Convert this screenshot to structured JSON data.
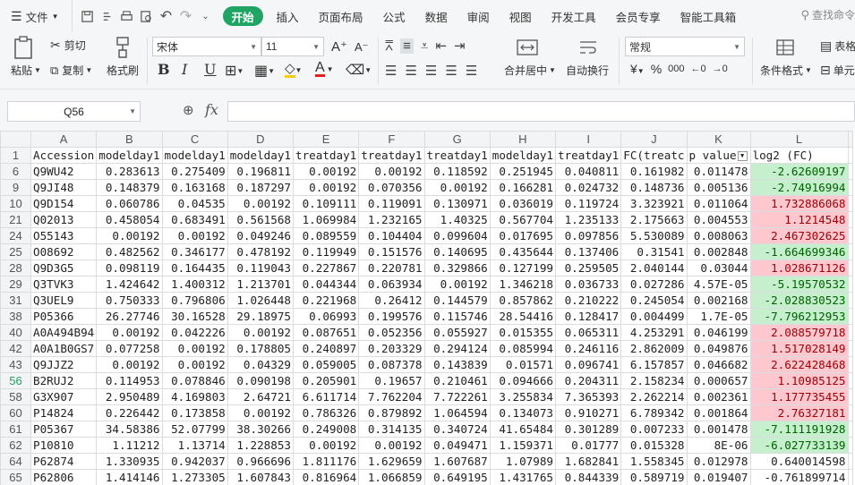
{
  "menubar": {
    "file_label": "文件",
    "tabs": [
      {
        "label": "开始",
        "active": true
      },
      {
        "label": "插入"
      },
      {
        "label": "页面布局"
      },
      {
        "label": "公式"
      },
      {
        "label": "数据"
      },
      {
        "label": "审阅"
      },
      {
        "label": "视图"
      },
      {
        "label": "开发工具"
      },
      {
        "label": "会员专享"
      },
      {
        "label": "智能工具箱"
      }
    ],
    "search_label": "查找命令"
  },
  "ribbon": {
    "paste": "粘贴",
    "cut": "剪切",
    "copy": "复制",
    "format_painter": "格式刷",
    "font_name": "宋体",
    "font_size": "11",
    "bold": "B",
    "italic": "I",
    "underline": "U",
    "font_color_letter": "A",
    "merge_center": "合并居中",
    "wrap_text": "自动换行",
    "number_format": "常规",
    "currency_symbol": "¥",
    "percent_symbol": "%",
    "thousands_symbol": "000",
    "conditional_format": "条件格式",
    "table_style": "表格",
    "cell_label": "单元",
    "font_grow": "A⁺",
    "font_shrink": "A⁻"
  },
  "formula_bar": {
    "name_box": "Q56",
    "fx": "fx",
    "formula": ""
  },
  "sheet": {
    "columns": [
      "A",
      "B",
      "C",
      "D",
      "E",
      "F",
      "G",
      "H",
      "I",
      "J",
      "K",
      "L"
    ],
    "header_row": {
      "row_num": "1",
      "cells": [
        "Accession",
        "modelday1",
        "modelday1",
        "modelday1",
        "treatday1",
        "treatday1",
        "treatday1",
        "modelday1",
        "treatday1",
        "FC(treatc",
        "p value",
        "log2 (FC)"
      ]
    },
    "rows": [
      {
        "n": "6",
        "cells": [
          "Q9WU42",
          "0.283613",
          "0.275409",
          "0.196811",
          "0.00192",
          "0.00192",
          "0.118592",
          "0.251945",
          "0.040811",
          "0.161982",
          "0.011478",
          "-2.62609197"
        ],
        "fill": "g"
      },
      {
        "n": "9",
        "cells": [
          "Q9JI48",
          "0.148379",
          "0.163168",
          "0.187297",
          "0.00192",
          "0.070356",
          "0.00192",
          "0.166281",
          "0.024732",
          "0.148736",
          "0.005136",
          "-2.74916994"
        ],
        "fill": "g"
      },
      {
        "n": "10",
        "cells": [
          "Q9D154",
          "0.060786",
          "0.04535",
          "0.00192",
          "0.109111",
          "0.119091",
          "0.130971",
          "0.036019",
          "0.119724",
          "3.323921",
          "0.011064",
          "1.732886068"
        ],
        "fill": "r"
      },
      {
        "n": "21",
        "cells": [
          "Q02013",
          "0.458054",
          "0.683491",
          "0.561568",
          "1.069984",
          "1.232165",
          "1.40325",
          "0.567704",
          "1.235133",
          "2.175663",
          "0.004553",
          "1.1214548"
        ],
        "fill": "r"
      },
      {
        "n": "24",
        "cells": [
          "O55143",
          "0.00192",
          "0.00192",
          "0.049246",
          "0.089559",
          "0.104404",
          "0.099604",
          "0.017695",
          "0.097856",
          "5.530089",
          "0.008063",
          "2.467302625"
        ],
        "fill": "r"
      },
      {
        "n": "25",
        "cells": [
          "O08692",
          "0.482562",
          "0.346177",
          "0.478192",
          "0.119949",
          "0.151576",
          "0.140695",
          "0.435644",
          "0.137406",
          "0.31541",
          "0.002848",
          "-1.664699346"
        ],
        "fill": "g"
      },
      {
        "n": "28",
        "cells": [
          "Q9D3G5",
          "0.098119",
          "0.164435",
          "0.119043",
          "0.227867",
          "0.220781",
          "0.329866",
          "0.127199",
          "0.259505",
          "2.040144",
          "0.03044",
          "1.028671126"
        ],
        "fill": "r"
      },
      {
        "n": "29",
        "cells": [
          "Q3TVK3",
          "1.424642",
          "1.400312",
          "1.213701",
          "0.044344",
          "0.063934",
          "0.00192",
          "1.346218",
          "0.036733",
          "0.027286",
          "4.57E-05",
          "-5.19570532"
        ],
        "fill": "g"
      },
      {
        "n": "31",
        "cells": [
          "Q3UEL9",
          "0.750333",
          "0.796806",
          "1.026448",
          "0.221968",
          "0.26412",
          "0.144579",
          "0.857862",
          "0.210222",
          "0.245054",
          "0.002168",
          "-2.028830523"
        ],
        "fill": "g"
      },
      {
        "n": "38",
        "cells": [
          "P05366",
          "26.27746",
          "30.16528",
          "29.18975",
          "0.06993",
          "0.199576",
          "0.115746",
          "28.54416",
          "0.128417",
          "0.004499",
          "1.7E-05",
          "-7.796212953"
        ],
        "fill": "g"
      },
      {
        "n": "40",
        "cells": [
          "A0A494B94",
          "0.00192",
          "0.042226",
          "0.00192",
          "0.087651",
          "0.052356",
          "0.055927",
          "0.015355",
          "0.065311",
          "4.253291",
          "0.046199",
          "2.088579718"
        ],
        "fill": "r"
      },
      {
        "n": "42",
        "cells": [
          "A0A1B0GS7",
          "0.077258",
          "0.00192",
          "0.178805",
          "0.240897",
          "0.203329",
          "0.294124",
          "0.085994",
          "0.246116",
          "2.862009",
          "0.049876",
          "1.517028149"
        ],
        "fill": "r"
      },
      {
        "n": "43",
        "cells": [
          "Q9JJZ2",
          "0.00192",
          "0.00192",
          "0.04329",
          "0.059005",
          "0.087378",
          "0.143839",
          "0.01571",
          "0.096741",
          "6.157857",
          "0.046682",
          "2.622428468"
        ],
        "fill": "r"
      },
      {
        "n": "56",
        "cells": [
          "B2RUJ2",
          "0.114953",
          "0.078846",
          "0.090198",
          "0.205901",
          "0.19657",
          "0.210461",
          "0.094666",
          "0.204311",
          "2.158234",
          "0.000657",
          "1.10985125"
        ],
        "fill": "r",
        "selected": true
      },
      {
        "n": "58",
        "cells": [
          "G3X907",
          "2.950489",
          "4.169803",
          "2.64721",
          "6.611714",
          "7.762204",
          "7.722261",
          "3.255834",
          "7.365393",
          "2.262214",
          "0.002361",
          "1.177735455"
        ],
        "fill": "r"
      },
      {
        "n": "60",
        "cells": [
          "P14824",
          "0.226442",
          "0.173858",
          "0.00192",
          "0.786326",
          "0.879892",
          "1.064594",
          "0.134073",
          "0.910271",
          "6.789342",
          "0.001864",
          "2.76327181"
        ],
        "fill": "r"
      },
      {
        "n": "61",
        "cells": [
          "P05367",
          "34.58386",
          "52.07799",
          "38.30266",
          "0.249008",
          "0.314135",
          "0.340724",
          "41.65484",
          "0.301289",
          "0.007233",
          "0.001478",
          "-7.111191928"
        ],
        "fill": "g"
      },
      {
        "n": "62",
        "cells": [
          "P10810",
          "1.11212",
          "1.13714",
          "1.228853",
          "0.00192",
          "0.00192",
          "0.049471",
          "1.159371",
          "0.01777",
          "0.015328",
          "8E-06",
          "-6.027733139"
        ],
        "fill": "g"
      },
      {
        "n": "64",
        "cells": [
          "P62874",
          "1.330935",
          "0.942037",
          "0.966696",
          "1.811176",
          "1.629659",
          "1.607687",
          "1.07989",
          "1.682841",
          "1.558345",
          "0.012978",
          "0.640014598"
        ],
        "fill": ""
      },
      {
        "n": "65",
        "cells": [
          "P62806",
          "1.414146",
          "1.273305",
          "1.607843",
          "0.816964",
          "1.066859",
          "0.649195",
          "1.431765",
          "0.844339",
          "0.589719",
          "0.019407",
          "-0.761899714"
        ],
        "fill": ""
      }
    ]
  }
}
